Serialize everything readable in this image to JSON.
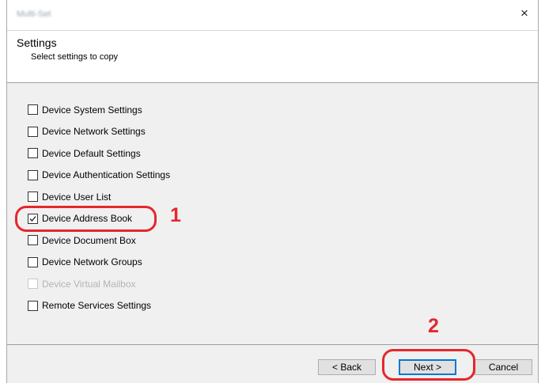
{
  "window": {
    "title": "Multi-Set",
    "close_glyph": "×"
  },
  "header": {
    "title": "Settings",
    "subtitle": "Select settings to copy"
  },
  "options": [
    {
      "label": "Device System Settings",
      "checked": false,
      "enabled": true
    },
    {
      "label": "Device Network Settings",
      "checked": false,
      "enabled": true
    },
    {
      "label": "Device Default Settings",
      "checked": false,
      "enabled": true
    },
    {
      "label": "Device Authentication Settings",
      "checked": false,
      "enabled": true
    },
    {
      "label": "Device User List",
      "checked": false,
      "enabled": true
    },
    {
      "label": "Device Address Book",
      "checked": true,
      "enabled": true
    },
    {
      "label": "Device Document Box",
      "checked": false,
      "enabled": true
    },
    {
      "label": "Device Network Groups",
      "checked": false,
      "enabled": true
    },
    {
      "label": "Device Virtual Mailbox",
      "checked": false,
      "enabled": false
    },
    {
      "label": "Remote Services Settings",
      "checked": false,
      "enabled": true
    }
  ],
  "buttons": {
    "back": "< Back",
    "next": "Next >",
    "cancel": "Cancel"
  },
  "annotations": {
    "step1": "1",
    "step2": "2"
  },
  "colors": {
    "annotation": "#e5262e",
    "default_button_border": "#0078d7"
  }
}
